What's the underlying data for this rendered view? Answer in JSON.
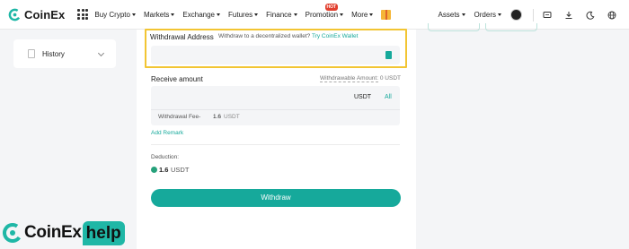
{
  "brand": {
    "name": "CoinEx",
    "accent": "#16a99b",
    "highlight": "#f2c533"
  },
  "nav": {
    "items": [
      "Buy Crypto",
      "Markets",
      "Exchange",
      "Futures",
      "Finance",
      "Promotion",
      "More"
    ],
    "promotion_badge": "HOT"
  },
  "right_nav": {
    "assets": "Assets",
    "orders": "Orders"
  },
  "sidebar": {
    "history_label": "History"
  },
  "withdraw": {
    "address_label": "Withdrawal Address",
    "address_hint": "Withdraw to a decentralized wallet?",
    "address_hint_link": "Try CoinEx Wallet",
    "receive_label": "Receive amount",
    "withdrawable_label": "Withdrawable Amount:",
    "withdrawable_value": "0",
    "withdrawable_unit": "USDT",
    "amount_unit": "USDT",
    "all_label": "All",
    "fee_label": "Withdrawal Fee-",
    "fee_value": "1.6",
    "fee_unit": "USDT",
    "add_remark": "Add Remark",
    "deduction_label": "Deduction:",
    "deduction_value": "1.6",
    "deduction_unit": "USDT",
    "submit_label": "Withdraw"
  },
  "watermark": {
    "text": "CoinEx",
    "help": "help"
  }
}
